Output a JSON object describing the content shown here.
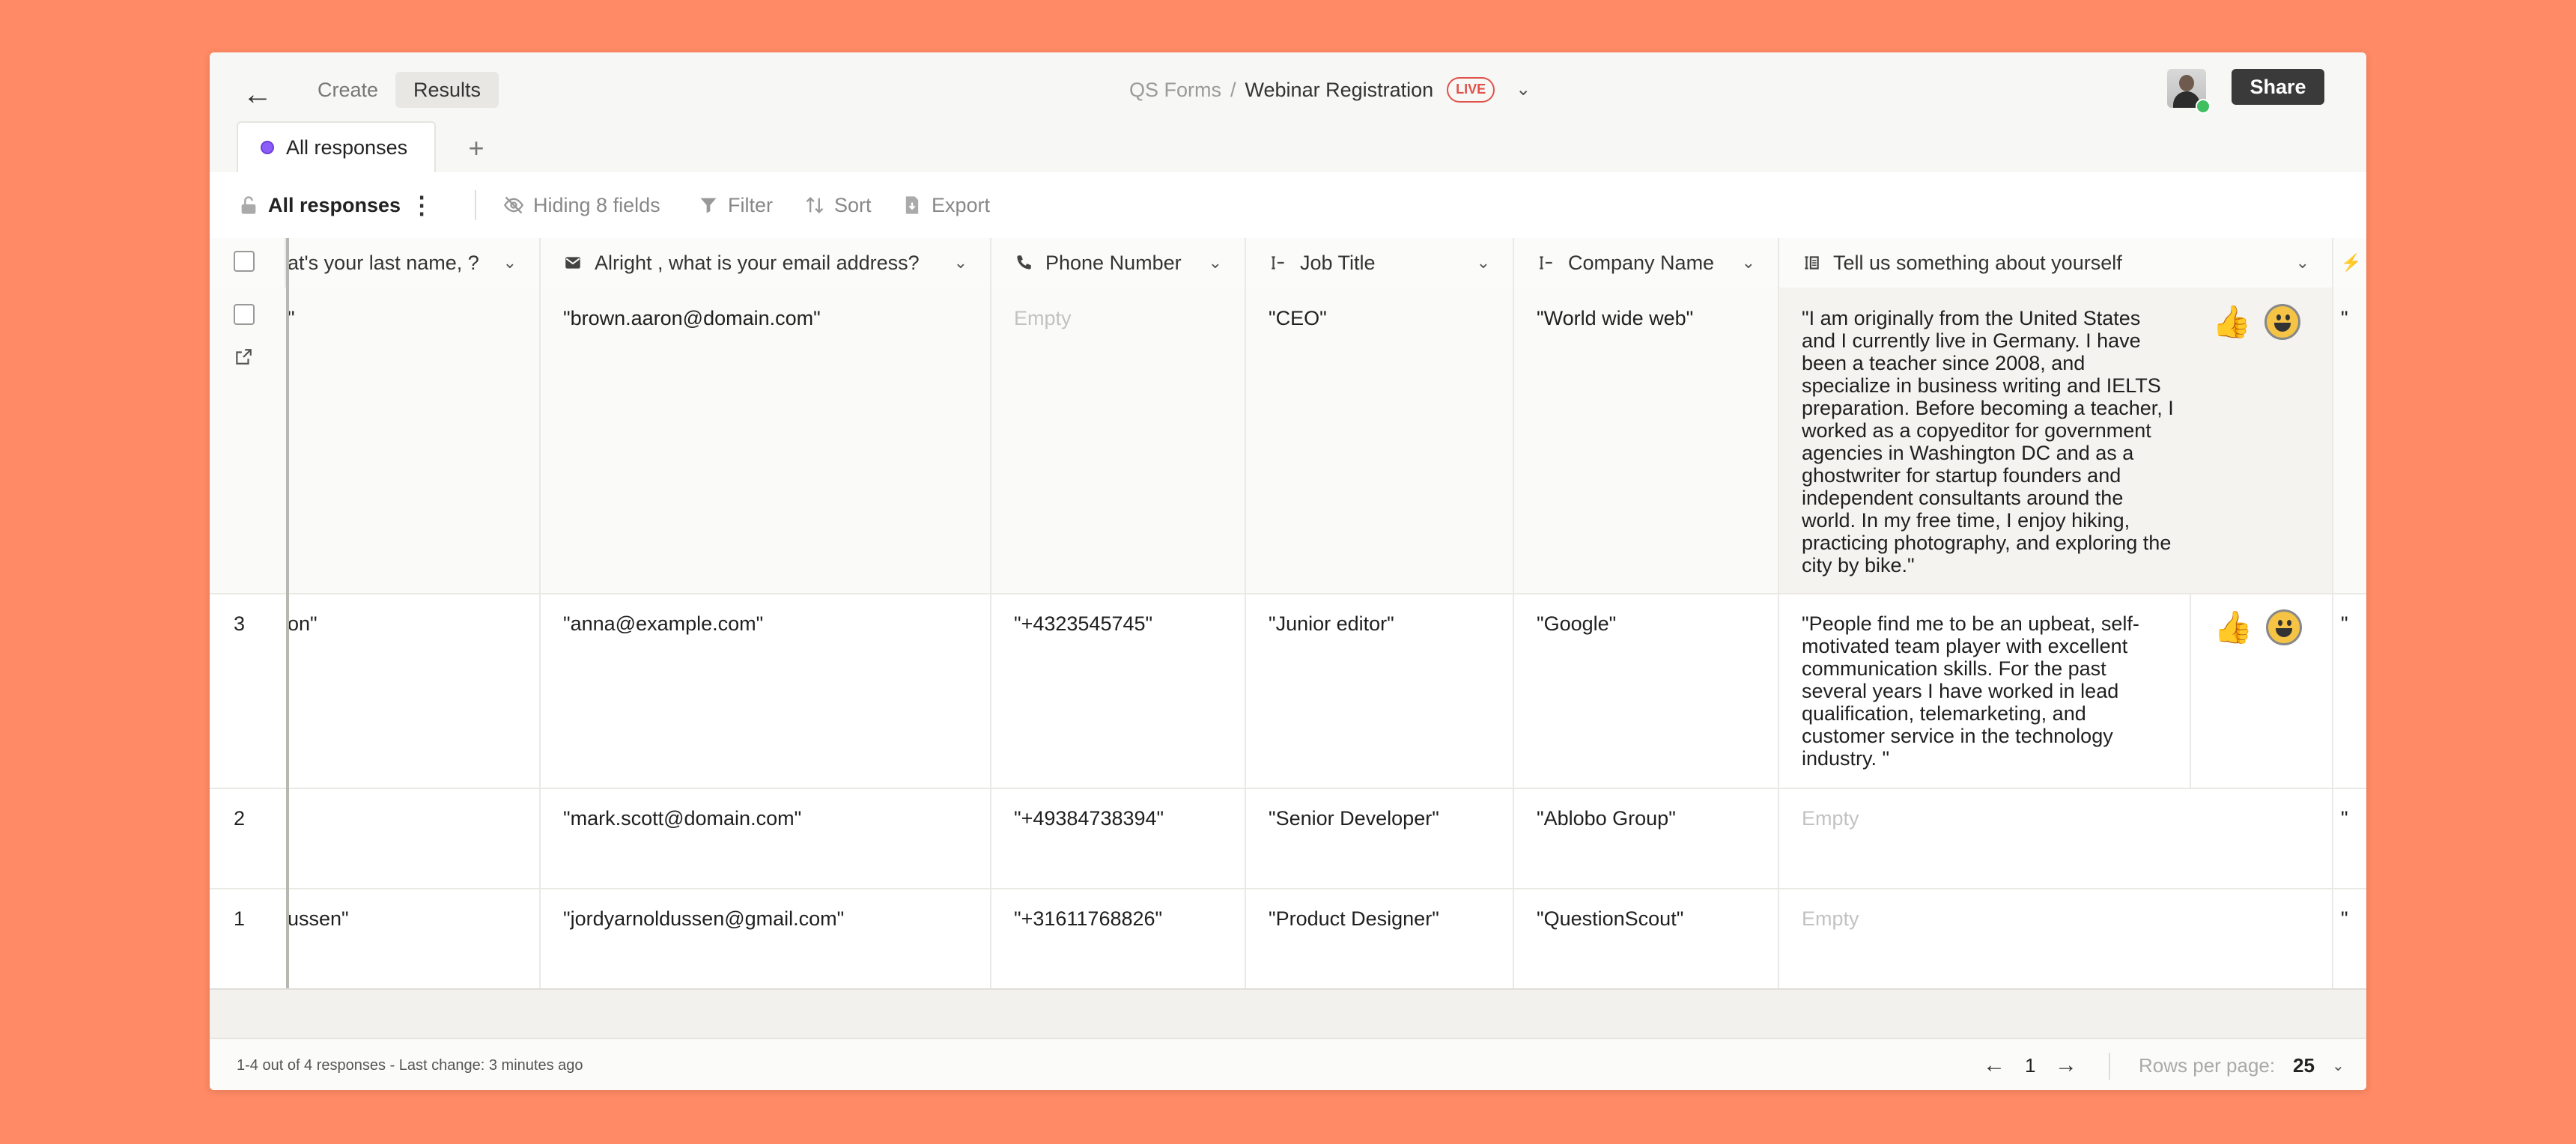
{
  "header": {
    "tabs": [
      "Create",
      "Results"
    ],
    "active_tab": "Results",
    "breadcrumb_root": "QS Forms",
    "breadcrumb_separator": "/",
    "form_title": "Webinar Registration",
    "status_badge": "LIVE",
    "share_label": "Share"
  },
  "view_tabs": {
    "active": "All responses",
    "add": "+"
  },
  "toolbar": {
    "view_name": "All responses",
    "hiding": "Hiding 8 fields",
    "filter": "Filter",
    "sort": "Sort",
    "export": "Export"
  },
  "columns": [
    "at's your last name, ?",
    "Alright , what is your email address?",
    "Phone Number",
    "Job Title",
    "Company Name",
    "Tell us something about yourself"
  ],
  "rows": [
    {
      "num": "",
      "last_name": "\"",
      "email": "\"brown.aaron@domain.com\"",
      "phone": "Empty",
      "job": "\"CEO\"",
      "company": "\"World wide web\"",
      "about": "\"I am originally from the United States and I currently live in Germany. I have been a teacher since 2008, and specialize in business writing and IELTS preparation. Before becoming a teacher, I worked as a copyeditor for government agencies in Washington DC and as a ghostwriter for startup founders and independent consultants around the world. In my free time, I enjoy hiking, practicing photography, and exploring the city by bike.\"",
      "cut": "\""
    },
    {
      "num": "3",
      "last_name": "on\"",
      "email": "\"anna@example.com\"",
      "phone": "\"+4323545745\"",
      "job": "\"Junior editor\"",
      "company": "\"Google\"",
      "about": "\"People find me to be an upbeat, self-motivated team player with excellent communication skills. For the past several years I have worked in lead qualification, telemarketing, and customer service in the technology industry. \"",
      "cut": "\""
    },
    {
      "num": "2",
      "last_name": "",
      "email": "\"mark.scott@domain.com\"",
      "phone": "\"+49384738394\"",
      "job": "\"Senior Developer\"",
      "company": "\"Ablobo Group\"",
      "about": "Empty",
      "cut": "\""
    },
    {
      "num": "1",
      "last_name": "ussen\"",
      "email": "\"jordyarnoldussen@gmail.com\"",
      "phone": "\"+31611768826\"",
      "job": "\"Product Designer\"",
      "company": "\"QuestionScout\"",
      "about": "Empty",
      "cut": "\""
    }
  ],
  "footer": {
    "status": "1-4 out of 4 responses - Last change: 3 minutes ago",
    "page": "1",
    "rows_per_page_label": "Rows per page:",
    "rows_per_page": "25"
  }
}
